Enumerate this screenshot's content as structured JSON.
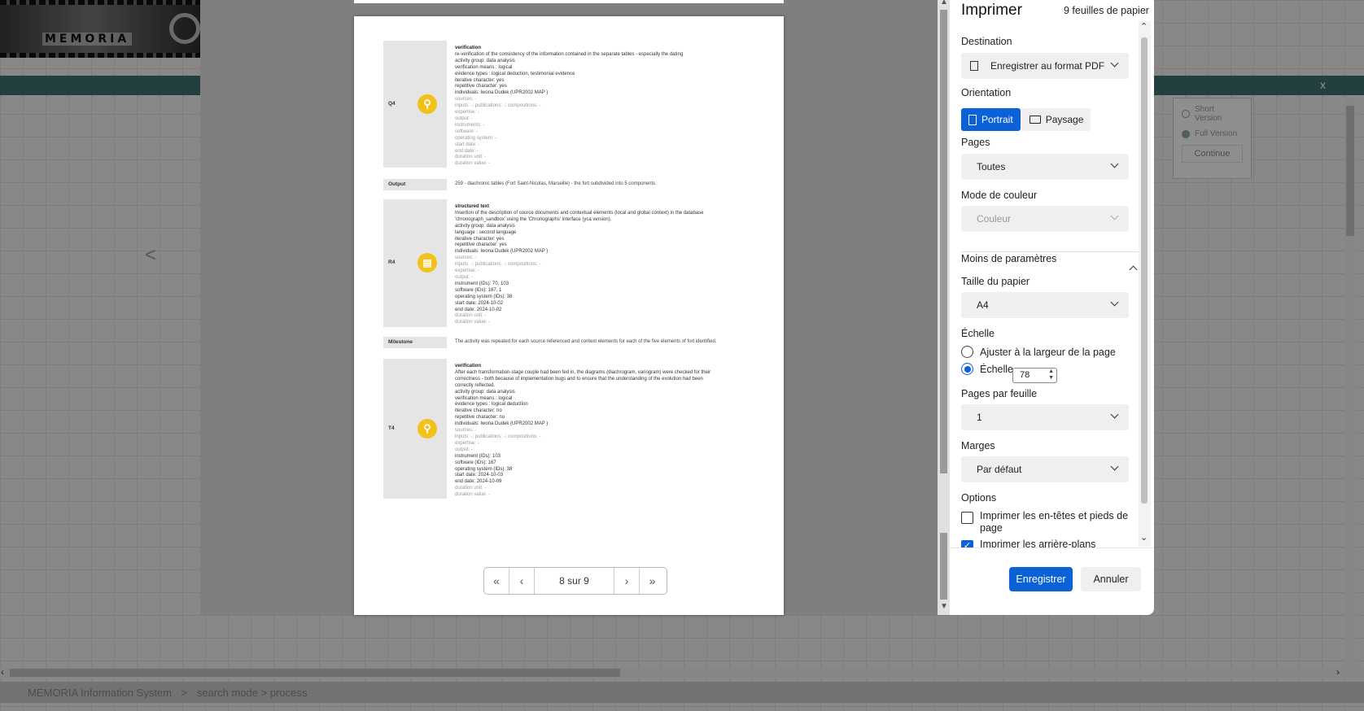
{
  "background": {
    "banner_logo": "MEMORIA",
    "close_label": "x",
    "side_options": [
      "Short Version",
      "Full Version"
    ],
    "continue_label": "Continue",
    "back_arrow": "<",
    "breadcrumb": [
      "MEMORIA  Information System",
      ">",
      "search mode > process"
    ]
  },
  "preview": {
    "blocks": [
      {
        "code": "Q4",
        "icon": "lightbulb-icon",
        "heading": "verification",
        "desc": [
          "re-verification of the consistency of the information contained in the separate tables - especially the dating"
        ],
        "lines": [
          {
            "t": "activity group: data analysis",
            "c": "d"
          },
          {
            "t": "verification means : logical",
            "c": "d"
          },
          {
            "t": "evidence types : logical deduction, testimonial evidence",
            "c": "d"
          },
          {
            "t": "iterative character: yes",
            "c": "d"
          },
          {
            "t": "repetitive character: yes",
            "c": "d"
          },
          {
            "t": "individuals: Iwona Dudek (UPR2002 MAP )",
            "c": "d"
          },
          {
            "t": "sources: -",
            "c": "g"
          },
          {
            "t": "inputs: -; publications: -; compositions: -",
            "c": "g"
          },
          {
            "t": "expertise: -",
            "c": "g"
          },
          {
            "t": "output: -",
            "c": "g"
          },
          {
            "t": "instruments: -",
            "c": "g"
          },
          {
            "t": "software: -",
            "c": "g"
          },
          {
            "t": "operating system: -",
            "c": "g"
          },
          {
            "t": "start date: -",
            "c": "g"
          },
          {
            "t": "end date: -",
            "c": "g"
          },
          {
            "t": "duration unit: -",
            "c": "g"
          },
          {
            "t": "duration value: -",
            "c": "g"
          }
        ]
      },
      {
        "code": "Output",
        "text": "259 - diachronic tables (Fort Saint-Nicolas, Marseille) - the fort subdivided into 5 components"
      },
      {
        "code": "R4",
        "icon": "document-icon",
        "heading": "structured text",
        "desc": [
          "Insertion of the description of source documents and contextual elements (local and global context) in the database",
          "'chronograph_sandbox' using the 'Chronographs' interface (yca version)."
        ],
        "lines": [
          {
            "t": "activity group: data analysis",
            "c": "d"
          },
          {
            "t": "language : second language",
            "c": "d"
          },
          {
            "t": "iterative character: yes",
            "c": "d"
          },
          {
            "t": "repetitive character: yes",
            "c": "d"
          },
          {
            "t": "individuals: Iwona Dudek (UPR2002 MAP )",
            "c": "d"
          },
          {
            "t": "sources: -",
            "c": "g"
          },
          {
            "t": "inputs: -; publications: -; compositions: -",
            "c": "g"
          },
          {
            "t": "expertise: -",
            "c": "g"
          },
          {
            "t": "output: -",
            "c": "g"
          },
          {
            "t": "instrument (IDs): 70, 103",
            "c": "d"
          },
          {
            "t": "software (IDs): 167, 1",
            "c": "d"
          },
          {
            "t": "operating system (IDs): 38",
            "c": "d"
          },
          {
            "t": "start date: 2024-10-02",
            "c": "d"
          },
          {
            "t": "end date: 2024-10-02",
            "c": "d"
          },
          {
            "t": "duration unit: -",
            "c": "g"
          },
          {
            "t": "duration value: -",
            "c": "g"
          }
        ]
      },
      {
        "code": "Milestone",
        "text": "The activity was repeated for each source referenced and context elements for each of the five elements of fort identified."
      },
      {
        "code": "T4",
        "icon": "lightbulb-icon",
        "heading": "verification",
        "desc": [
          "After each transformation-stage couple had been fed in, the diagrams (diachrogram, variogram) were checked for their",
          "correctness - both because of implementation bugs and to ensure that the understanding of the evolution had been",
          "correctly reflected."
        ],
        "lines": [
          {
            "t": "activity group: data analysis",
            "c": "d"
          },
          {
            "t": "verification means : logical",
            "c": "d"
          },
          {
            "t": "evidence types : logical deduction",
            "c": "d"
          },
          {
            "t": "iterative character: no",
            "c": "d"
          },
          {
            "t": "repetitive character: no",
            "c": "d"
          },
          {
            "t": "individuals: Iwona Dudek (UPR2002 MAP )",
            "c": "d"
          },
          {
            "t": "sources: -",
            "c": "g"
          },
          {
            "t": "inputs: -; publications: -; compositions: -",
            "c": "g"
          },
          {
            "t": "expertise: -",
            "c": "g"
          },
          {
            "t": "output: -",
            "c": "g"
          },
          {
            "t": "instrument (IDs): 103",
            "c": "d"
          },
          {
            "t": "software (IDs): 167",
            "c": "d"
          },
          {
            "t": "operating system (IDs): 38",
            "c": "d"
          },
          {
            "t": "start date: 2024-10-03",
            "c": "d"
          },
          {
            "t": "end date: 2024-10-09",
            "c": "d"
          },
          {
            "t": "duration unit: -",
            "c": "g"
          },
          {
            "t": "duration value: -",
            "c": "g"
          }
        ]
      }
    ],
    "pager": {
      "first": "«",
      "prev": "‹",
      "page": "8 sur 9",
      "next": "›",
      "last": "»"
    }
  },
  "print": {
    "title": "Imprimer",
    "sheets": "9 feuilles de papier",
    "destination_label": "Destination",
    "destination_value": "Enregistrer au format PDF",
    "orientation_label": "Orientation",
    "portrait": "Portrait",
    "landscape": "Paysage",
    "pages_label": "Pages",
    "pages_value": "Toutes",
    "color_label": "Mode de couleur",
    "color_value": "Couleur",
    "fewer_settings": "Moins de paramètres",
    "paper_label": "Taille du papier",
    "paper_value": "A4",
    "scale_label": "Échelle",
    "fit_width": "Ajuster à la largeur de la page",
    "scale_option": "Échelle",
    "scale_value": "78",
    "pps_label": "Pages par feuille",
    "pps_value": "1",
    "margins_label": "Marges",
    "margins_value": "Par défaut",
    "options_label": "Options",
    "opt_headers": "Imprimer les en-têtes et pieds de page",
    "opt_backgrounds": "Imprimer les arrière-plans",
    "save": "Enregistrer",
    "cancel": "Annuler"
  },
  "colors": {
    "accent": "#0b62d6",
    "icon": "#f2c21b",
    "teal": "#3f6f6f"
  }
}
